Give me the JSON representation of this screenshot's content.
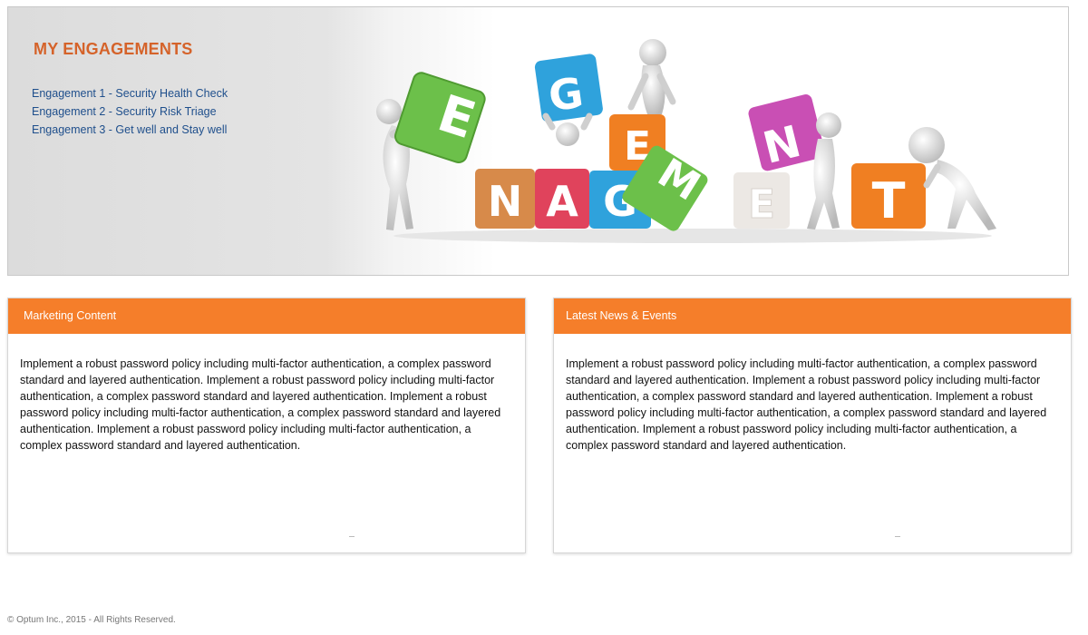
{
  "banner": {
    "title": "MY ENGAGEMENTS",
    "engagements": [
      "Engagement 1 - Security Health Check",
      "Engagement 2 - Security Risk Triage",
      "Engagement 3 - Get well and Stay well"
    ],
    "cube_letters": [
      "E",
      "G",
      "E",
      "N",
      "N",
      "A",
      "G",
      "M",
      "E",
      "T"
    ],
    "cube_colors": {
      "green": "#6cc04a",
      "blue": "#2fa2dc",
      "orange": "#f07f22",
      "red": "#e0435c",
      "magenta": "#c94fb4",
      "tan": "#d78a4a",
      "light": "#ece8e4"
    }
  },
  "panels": {
    "marketing": {
      "title": "Marketing Content",
      "body": "Implement a robust password policy including multi-factor authentication, a complex password standard and layered authentication. Implement a robust password policy including multi-factor authentication, a complex password standard and layered authentication. Implement a robust password policy including multi-factor authentication, a complex password standard and layered authentication. Implement a robust password policy including multi-factor authentication, a complex password standard and layered authentication."
    },
    "news": {
      "title": "Latest News & Events",
      "body": "Implement a robust password policy including multi-factor authentication, a complex password standard and layered authentication. Implement a robust password policy including multi-factor authentication, a complex password standard and layered authentication. Implement a robust password policy including multi-factor authentication, a complex password standard and layered authentication. Implement a robust password policy including multi-factor authentication, a complex password standard and layered authentication."
    }
  },
  "footer": {
    "copyright": "© Optum Inc., 2015 - All Rights Reserved."
  },
  "accent_colors": {
    "panel_header": "#f57e2a",
    "banner_title": "#d5632a",
    "link": "#1f4f8c"
  }
}
